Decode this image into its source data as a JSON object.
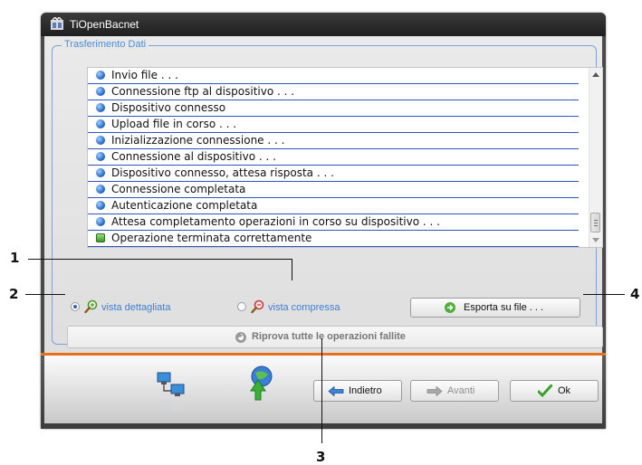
{
  "window": {
    "title": "TiOpenBacnet"
  },
  "group": {
    "title": "Trasferimento Dati"
  },
  "log": {
    "rows": [
      {
        "text": "Invio file . . .",
        "status": "info"
      },
      {
        "text": "Connessione ftp al dispositivo . . .",
        "status": "info"
      },
      {
        "text": "Dispositivo connesso",
        "status": "info"
      },
      {
        "text": "Upload file in corso . . .",
        "status": "info"
      },
      {
        "text": "Inizializzazione connessione . . .",
        "status": "info"
      },
      {
        "text": "Connessione al dispositivo . . .",
        "status": "info"
      },
      {
        "text": "Dispositivo connesso, attesa risposta . . .",
        "status": "info"
      },
      {
        "text": "Connessione completata",
        "status": "info"
      },
      {
        "text": "Autenticazione completata",
        "status": "info"
      },
      {
        "text": "Attesa completamento operazioni in corso su dispositivo . . .",
        "status": "info"
      },
      {
        "text": "Operazione terminata correttamente",
        "status": "ok"
      }
    ]
  },
  "view_options": {
    "detailed": "vista dettagliata",
    "compressed": "vista compressa",
    "selected": "detailed"
  },
  "buttons": {
    "export": "Esporta su file . . .",
    "retry": "Riprova tutte le operazioni fallite",
    "back": "Indietro",
    "next": "Avanti",
    "ok": "Ok"
  },
  "callouts": {
    "c1": "1",
    "c2": "2",
    "c3": "3",
    "c4": "4"
  },
  "colors": {
    "accent": "#4a8fd6",
    "orange_bar": "#e8701c",
    "row_line": "#2f54c8"
  }
}
